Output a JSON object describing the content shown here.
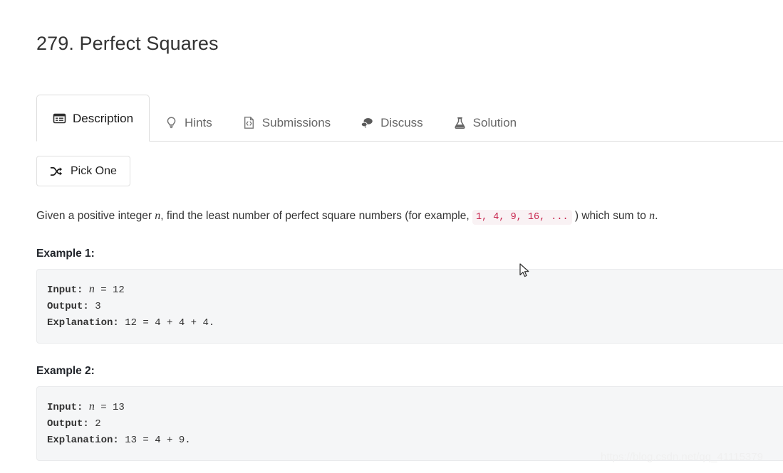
{
  "page": {
    "title": "279. Perfect Squares"
  },
  "tabs": [
    {
      "label": "Description",
      "icon": "description-icon",
      "active": true
    },
    {
      "label": "Hints",
      "icon": "lightbulb-icon",
      "active": false
    },
    {
      "label": "Submissions",
      "icon": "code-file-icon",
      "active": false
    },
    {
      "label": "Discuss",
      "icon": "chat-bubbles-icon",
      "active": false
    },
    {
      "label": "Solution",
      "icon": "flask-icon",
      "active": false
    }
  ],
  "toolbar": {
    "pick_one_label": "Pick One",
    "pick_one_icon": "shuffle-icon"
  },
  "description": {
    "part1": "Given a positive integer ",
    "var1": "n",
    "part2": ", find the least number of perfect square numbers (for example, ",
    "code_example": "1, 4, 9, 16, ...",
    "part3": " ) which sum to ",
    "var2": "n",
    "part4": "."
  },
  "examples": [
    {
      "heading": "Example 1:",
      "input_label": "Input:",
      "input_var": "n",
      "input_value": " = 12",
      "output_label": "Output:",
      "output_value": " 3",
      "explanation_label": "Explanation:",
      "explanation_value": " 12 = 4 + 4 + 4."
    },
    {
      "heading": "Example 2:",
      "input_label": "Input:",
      "input_var": "n",
      "input_value": " = 13",
      "output_label": "Output:",
      "output_value": " 2",
      "explanation_label": "Explanation:",
      "explanation_value": " 13 = 4 + 9."
    }
  ],
  "watermark": {
    "text": "https://blog.csdn.net/qq_41115379"
  },
  "colors": {
    "inline_code_text": "#c7254e",
    "inline_code_background": "#f9f2f4",
    "code_block_background": "#f5f6f7",
    "tab_border": "#dddddd",
    "text_primary": "#333333",
    "text_muted": "#666666"
  }
}
